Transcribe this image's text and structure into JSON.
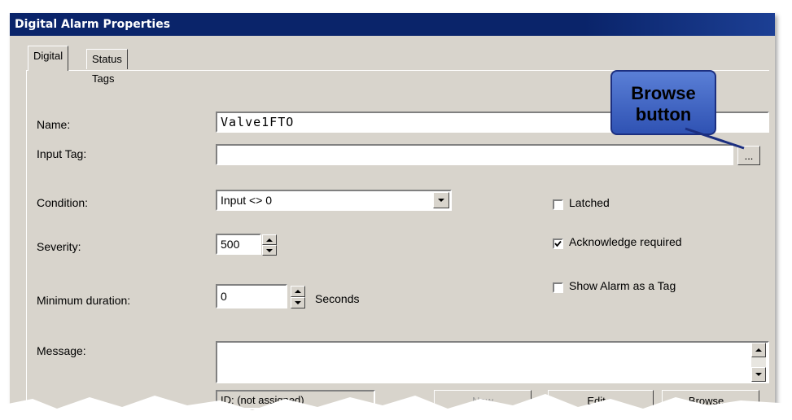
{
  "window": {
    "title": "Digital Alarm Properties"
  },
  "tabs": [
    {
      "label": "Digital"
    },
    {
      "label": "Status Tags"
    }
  ],
  "form": {
    "name_label": "Name:",
    "name_value": "Valve1FTO",
    "input_tag_label": "Input Tag:",
    "input_tag_value": "",
    "browse_small_label": "...",
    "condition_label": "Condition:",
    "condition_value": "Input <> 0",
    "severity_label": "Severity:",
    "severity_value": "500",
    "min_duration_label": "Minimum duration:",
    "min_duration_value": "0",
    "seconds_label": "Seconds",
    "message_label": "Message:",
    "message_value": "",
    "message_id": "ID: (not assigned)"
  },
  "options": {
    "latched": {
      "label": "Latched",
      "checked": false
    },
    "ack_required": {
      "label": "Acknowledge required",
      "checked": true
    },
    "show_as_tag": {
      "label": "Show Alarm as a Tag",
      "checked": false
    }
  },
  "buttons": {
    "new": "New",
    "edit": "Edit...",
    "browse": "Browse..."
  },
  "callout": {
    "line1": "Browse",
    "line2": "button"
  }
}
